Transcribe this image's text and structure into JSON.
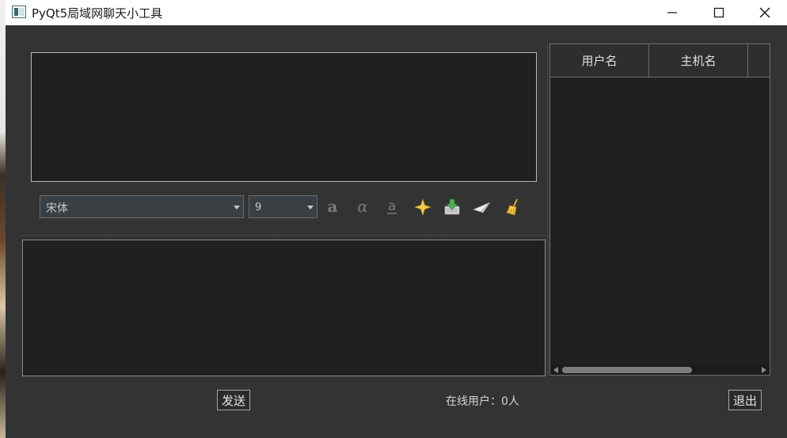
{
  "window": {
    "title": "PyQt5局域网聊天小工具",
    "controls": {
      "minimize": "minimize-icon",
      "maximize": "maximize-icon",
      "close": "close-icon"
    }
  },
  "toolbar": {
    "font_family": "宋体",
    "font_size": "9",
    "tools": [
      {
        "name": "bold-icon",
        "glyph": "a"
      },
      {
        "name": "italic-icon",
        "glyph": "α"
      },
      {
        "name": "underline-icon",
        "glyph": "a"
      },
      {
        "name": "color-icon",
        "glyph": "✦"
      },
      {
        "name": "save-icon",
        "glyph": "⬇"
      },
      {
        "name": "send-file-icon",
        "glyph": "✈"
      },
      {
        "name": "clear-icon",
        "glyph": "🧹"
      }
    ]
  },
  "user_table": {
    "columns": [
      "用户名",
      "主机名",
      ""
    ]
  },
  "footer": {
    "send_label": "发送",
    "online_users": "在线用户：0人",
    "exit_label": "退出"
  },
  "colors": {
    "background": "#333333",
    "panel": "#202020",
    "accent": "#f2c84b"
  }
}
